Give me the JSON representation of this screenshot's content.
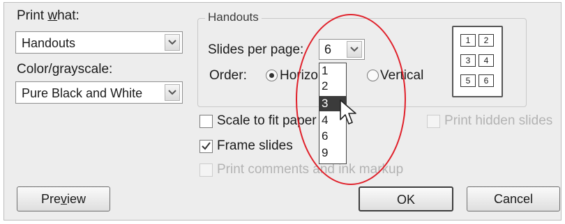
{
  "print_what": {
    "label": "Print what:",
    "value": "Handouts"
  },
  "color_grayscale": {
    "label": "Color/grayscale:",
    "value": "Pure Black and White"
  },
  "handouts": {
    "group_title": "Handouts",
    "slides_per_page_label": "Slides per page:",
    "slides_per_page_value": "6",
    "order_label": "Order:",
    "order_horizontal": "Horizo",
    "order_vertical": "Vertical",
    "dropdown_options": [
      "1",
      "2",
      "3",
      "4",
      "6",
      "9"
    ],
    "dropdown_selected": "3",
    "preview_slots": [
      "1",
      "2",
      "3",
      "4",
      "5",
      "6"
    ]
  },
  "options": {
    "scale_to_fit": "Scale to fit paper",
    "frame_slides": "Frame slides",
    "frame_slides_checked": true,
    "print_comments": "Print comments and ink markup",
    "print_hidden": "Print hidden slides"
  },
  "buttons": {
    "preview": "Preview",
    "ok": "OK",
    "cancel": "Cancel"
  },
  "colors": {
    "highlight": "#3b3b3b",
    "annotation": "#e0202a"
  }
}
